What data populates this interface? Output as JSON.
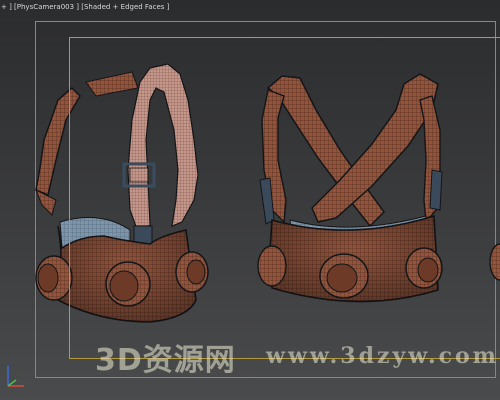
{
  "viewport": {
    "label": "+ ] [PhysCamera003 ] [Shaded + Edged Faces ]"
  },
  "watermark": {
    "cn": "3D资源网",
    "url": "www.3dzyw.com"
  },
  "colors": {
    "mesh_fill": "#9a5a40",
    "mesh_shadow": "#5e3222",
    "mesh_light": "#c99a86",
    "wire": "#1c1d22",
    "lining": "#7f98ac",
    "viewport_border": "#4b9fa8",
    "safe_frame": "#b49a3c"
  }
}
